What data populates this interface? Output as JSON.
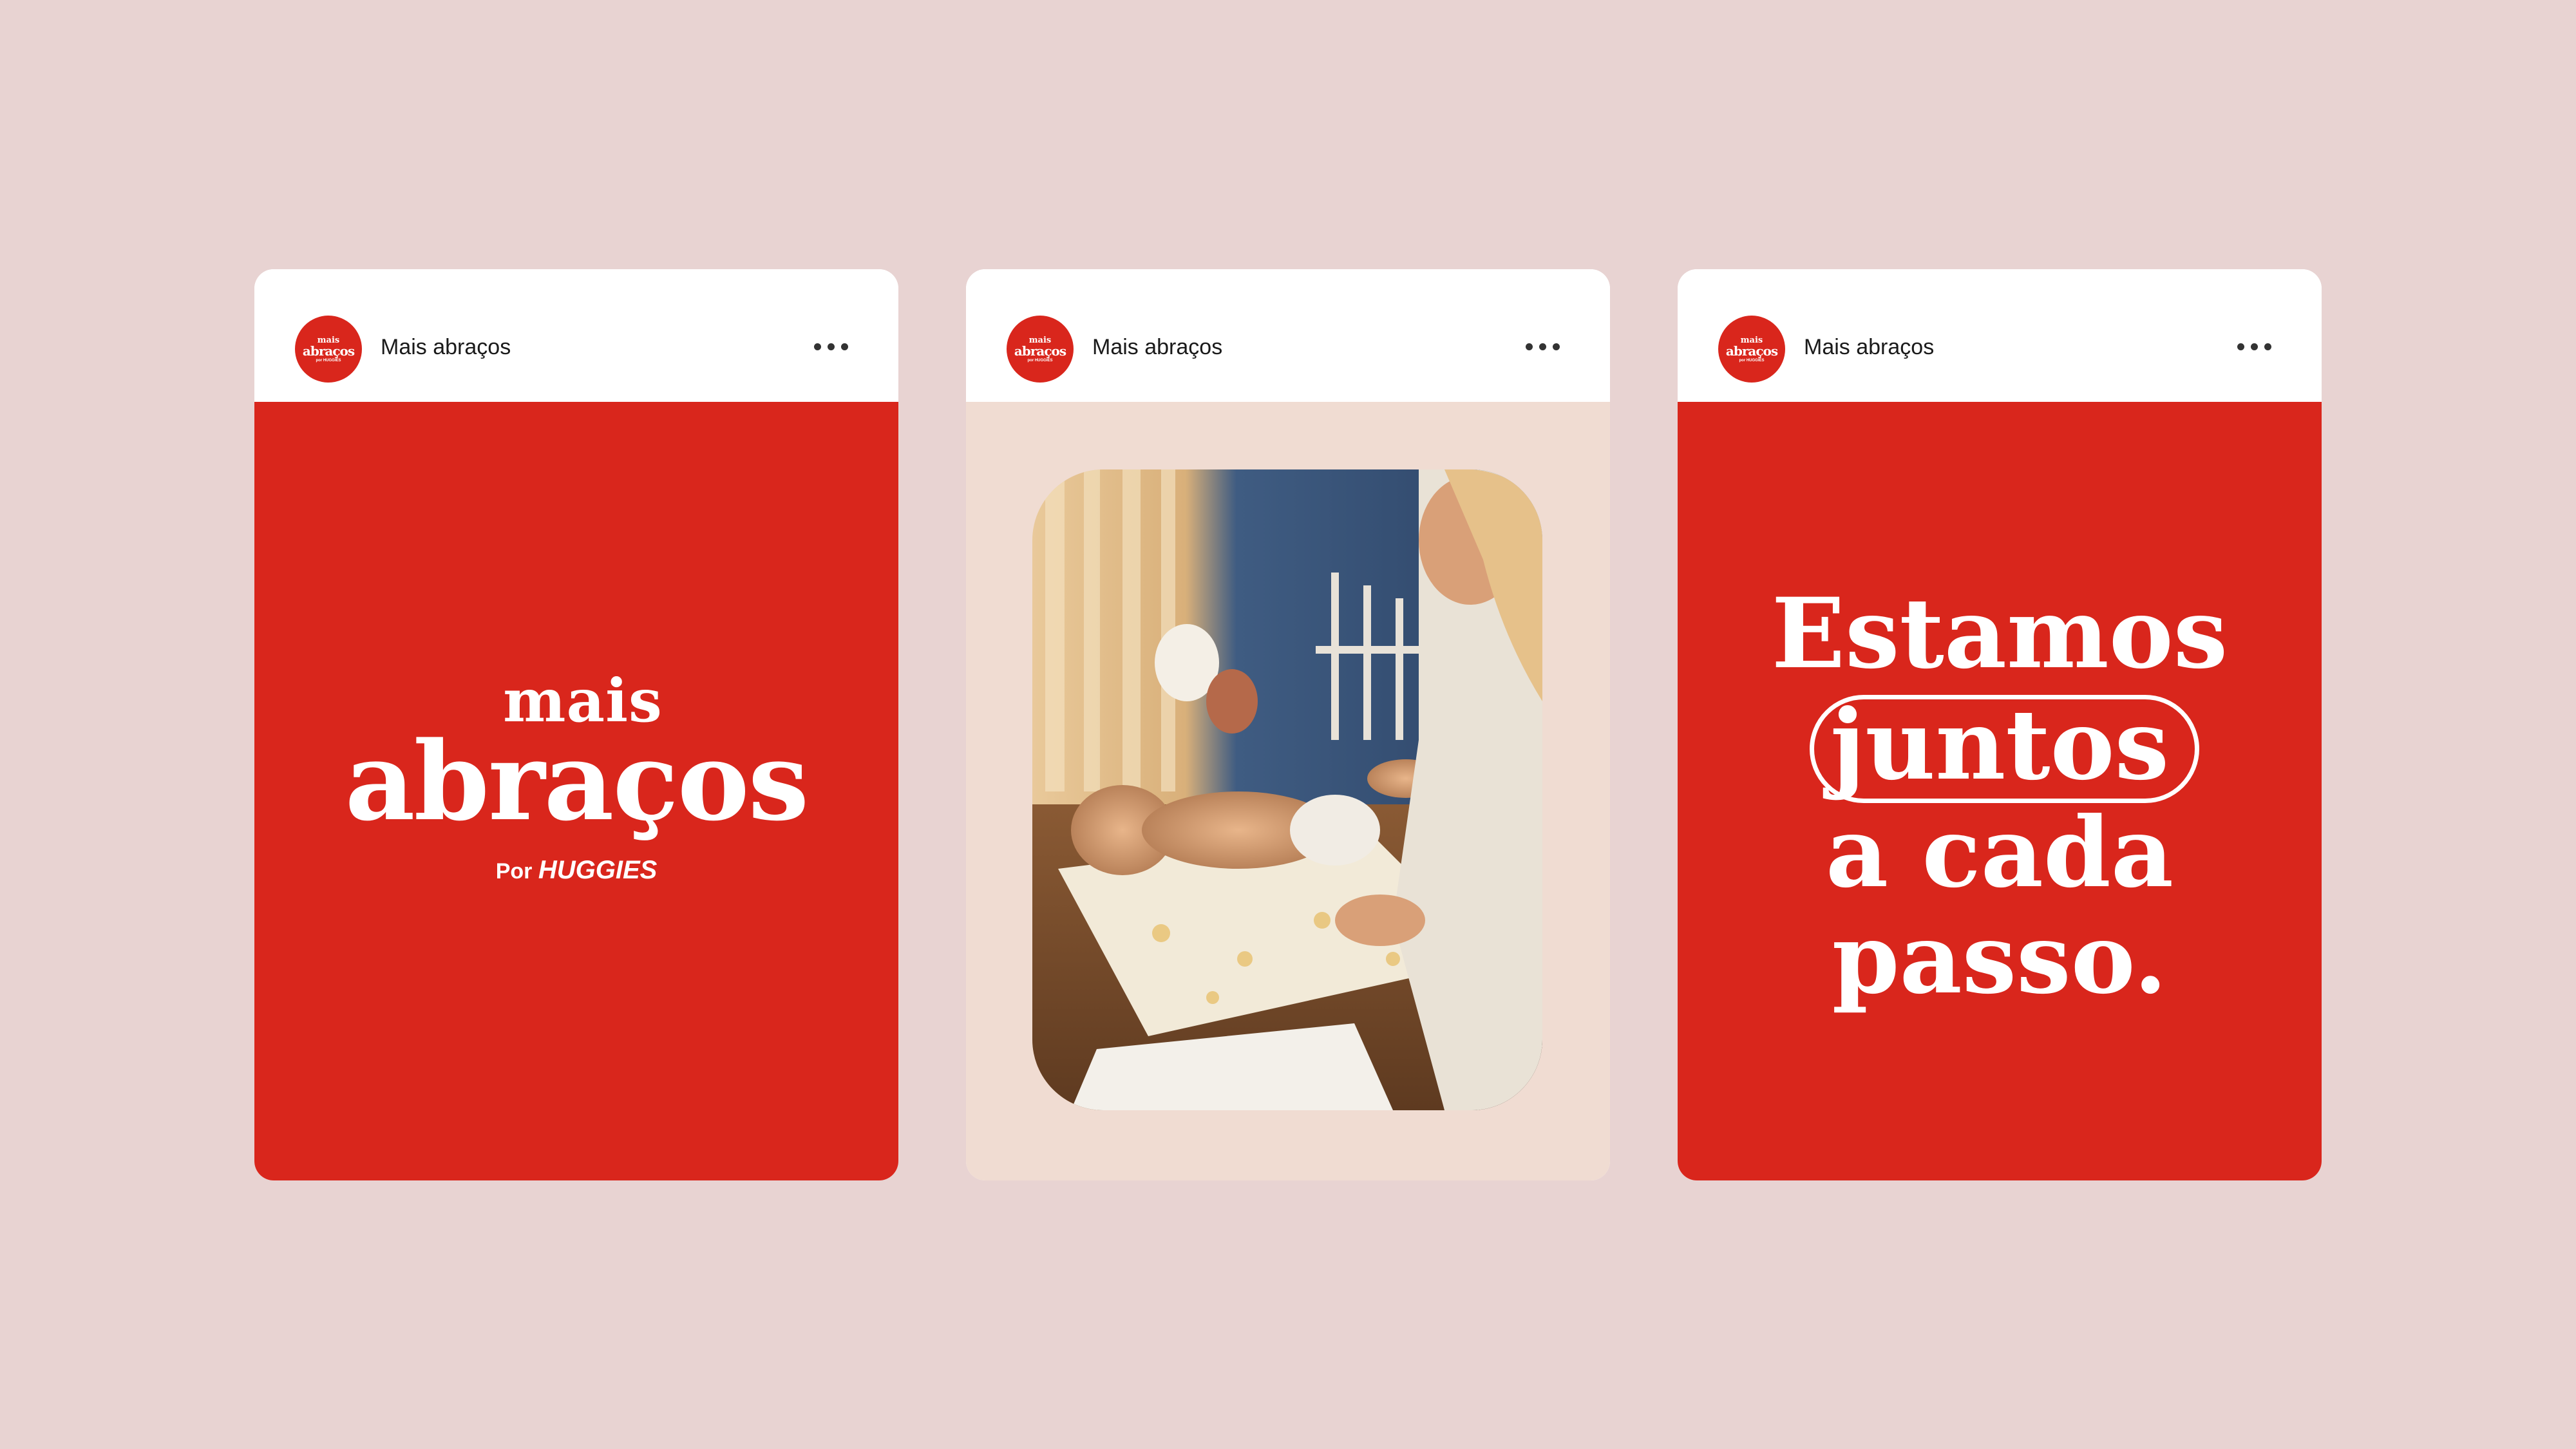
{
  "posts": [
    {
      "account": "Mais abraços",
      "avatar": {
        "line1": "mais",
        "line2": "abraços",
        "line3": "por HUGGIES"
      },
      "logo": {
        "line1": "mais",
        "line2": "abraços",
        "by": "Por",
        "brand": "HUGGIES"
      }
    },
    {
      "account": "Mais abraços",
      "avatar": {
        "line1": "mais",
        "line2": "abraços",
        "line3": "por HUGGIES"
      }
    },
    {
      "account": "Mais abraços",
      "avatar": {
        "line1": "mais",
        "line2": "abraços",
        "line3": "por HUGGIES"
      },
      "slogan": {
        "line1": "Estamos",
        "line2": "juntos",
        "line3": "a cada",
        "line4": "passo."
      }
    }
  ],
  "colors": {
    "brand_red": "#d9261c",
    "page_bg": "#e8d3d2",
    "beige": "#f0dcd2"
  },
  "icons": {
    "more": "more-horizontal-icon"
  }
}
